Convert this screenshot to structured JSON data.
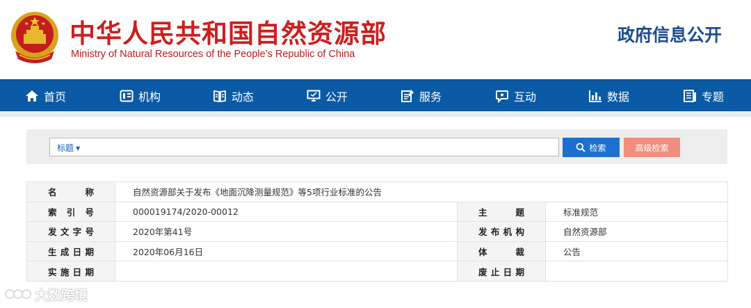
{
  "header": {
    "title_cn": "中华人民共和国自然资源部",
    "title_en": "Ministry of Natural Resources of the People’s Republic of China",
    "section_title": "政府信息公开"
  },
  "nav": {
    "items": [
      {
        "label": "首页",
        "icon": "home-icon"
      },
      {
        "label": "机构",
        "icon": "organization-icon"
      },
      {
        "label": "动态",
        "icon": "news-icon"
      },
      {
        "label": "公开",
        "icon": "disclosure-icon"
      },
      {
        "label": "服务",
        "icon": "service-icon"
      },
      {
        "label": "互动",
        "icon": "chat-icon"
      },
      {
        "label": "数据",
        "icon": "bar-chart-icon"
      },
      {
        "label": "专题",
        "icon": "topic-icon"
      }
    ]
  },
  "search": {
    "type_label": "标题",
    "placeholder": "",
    "search_label": "检索",
    "advanced_label": "高级检索"
  },
  "info": {
    "name_label": "名称",
    "name_value": "自然资源部关于发布《地面沉降测量规范》等5项行业标准的公告",
    "index_label": "索引号",
    "index_value": "000019174/2020-00012",
    "topic_label": "主题",
    "topic_value": "标准规范",
    "doc_no_label": "发文字号",
    "doc_no_value": "2020年第41号",
    "publisher_label": "发布机构",
    "publisher_value": "自然资源部",
    "created_label": "生成日期",
    "created_value": "2020年06月16日",
    "genre_label": "体裁",
    "genre_value": "公告",
    "effective_label": "实施日期",
    "effective_value": "",
    "expiry_label": "废止日期",
    "expiry_value": ""
  },
  "watermark": {
    "text": "大数跨境"
  },
  "colors": {
    "brand_red": "#cc1f1f",
    "nav_blue": "#0a5aa6",
    "search_button": "#1e6fcf",
    "advanced_button": "#f08f7e",
    "section_title": "#1a4d8f"
  }
}
